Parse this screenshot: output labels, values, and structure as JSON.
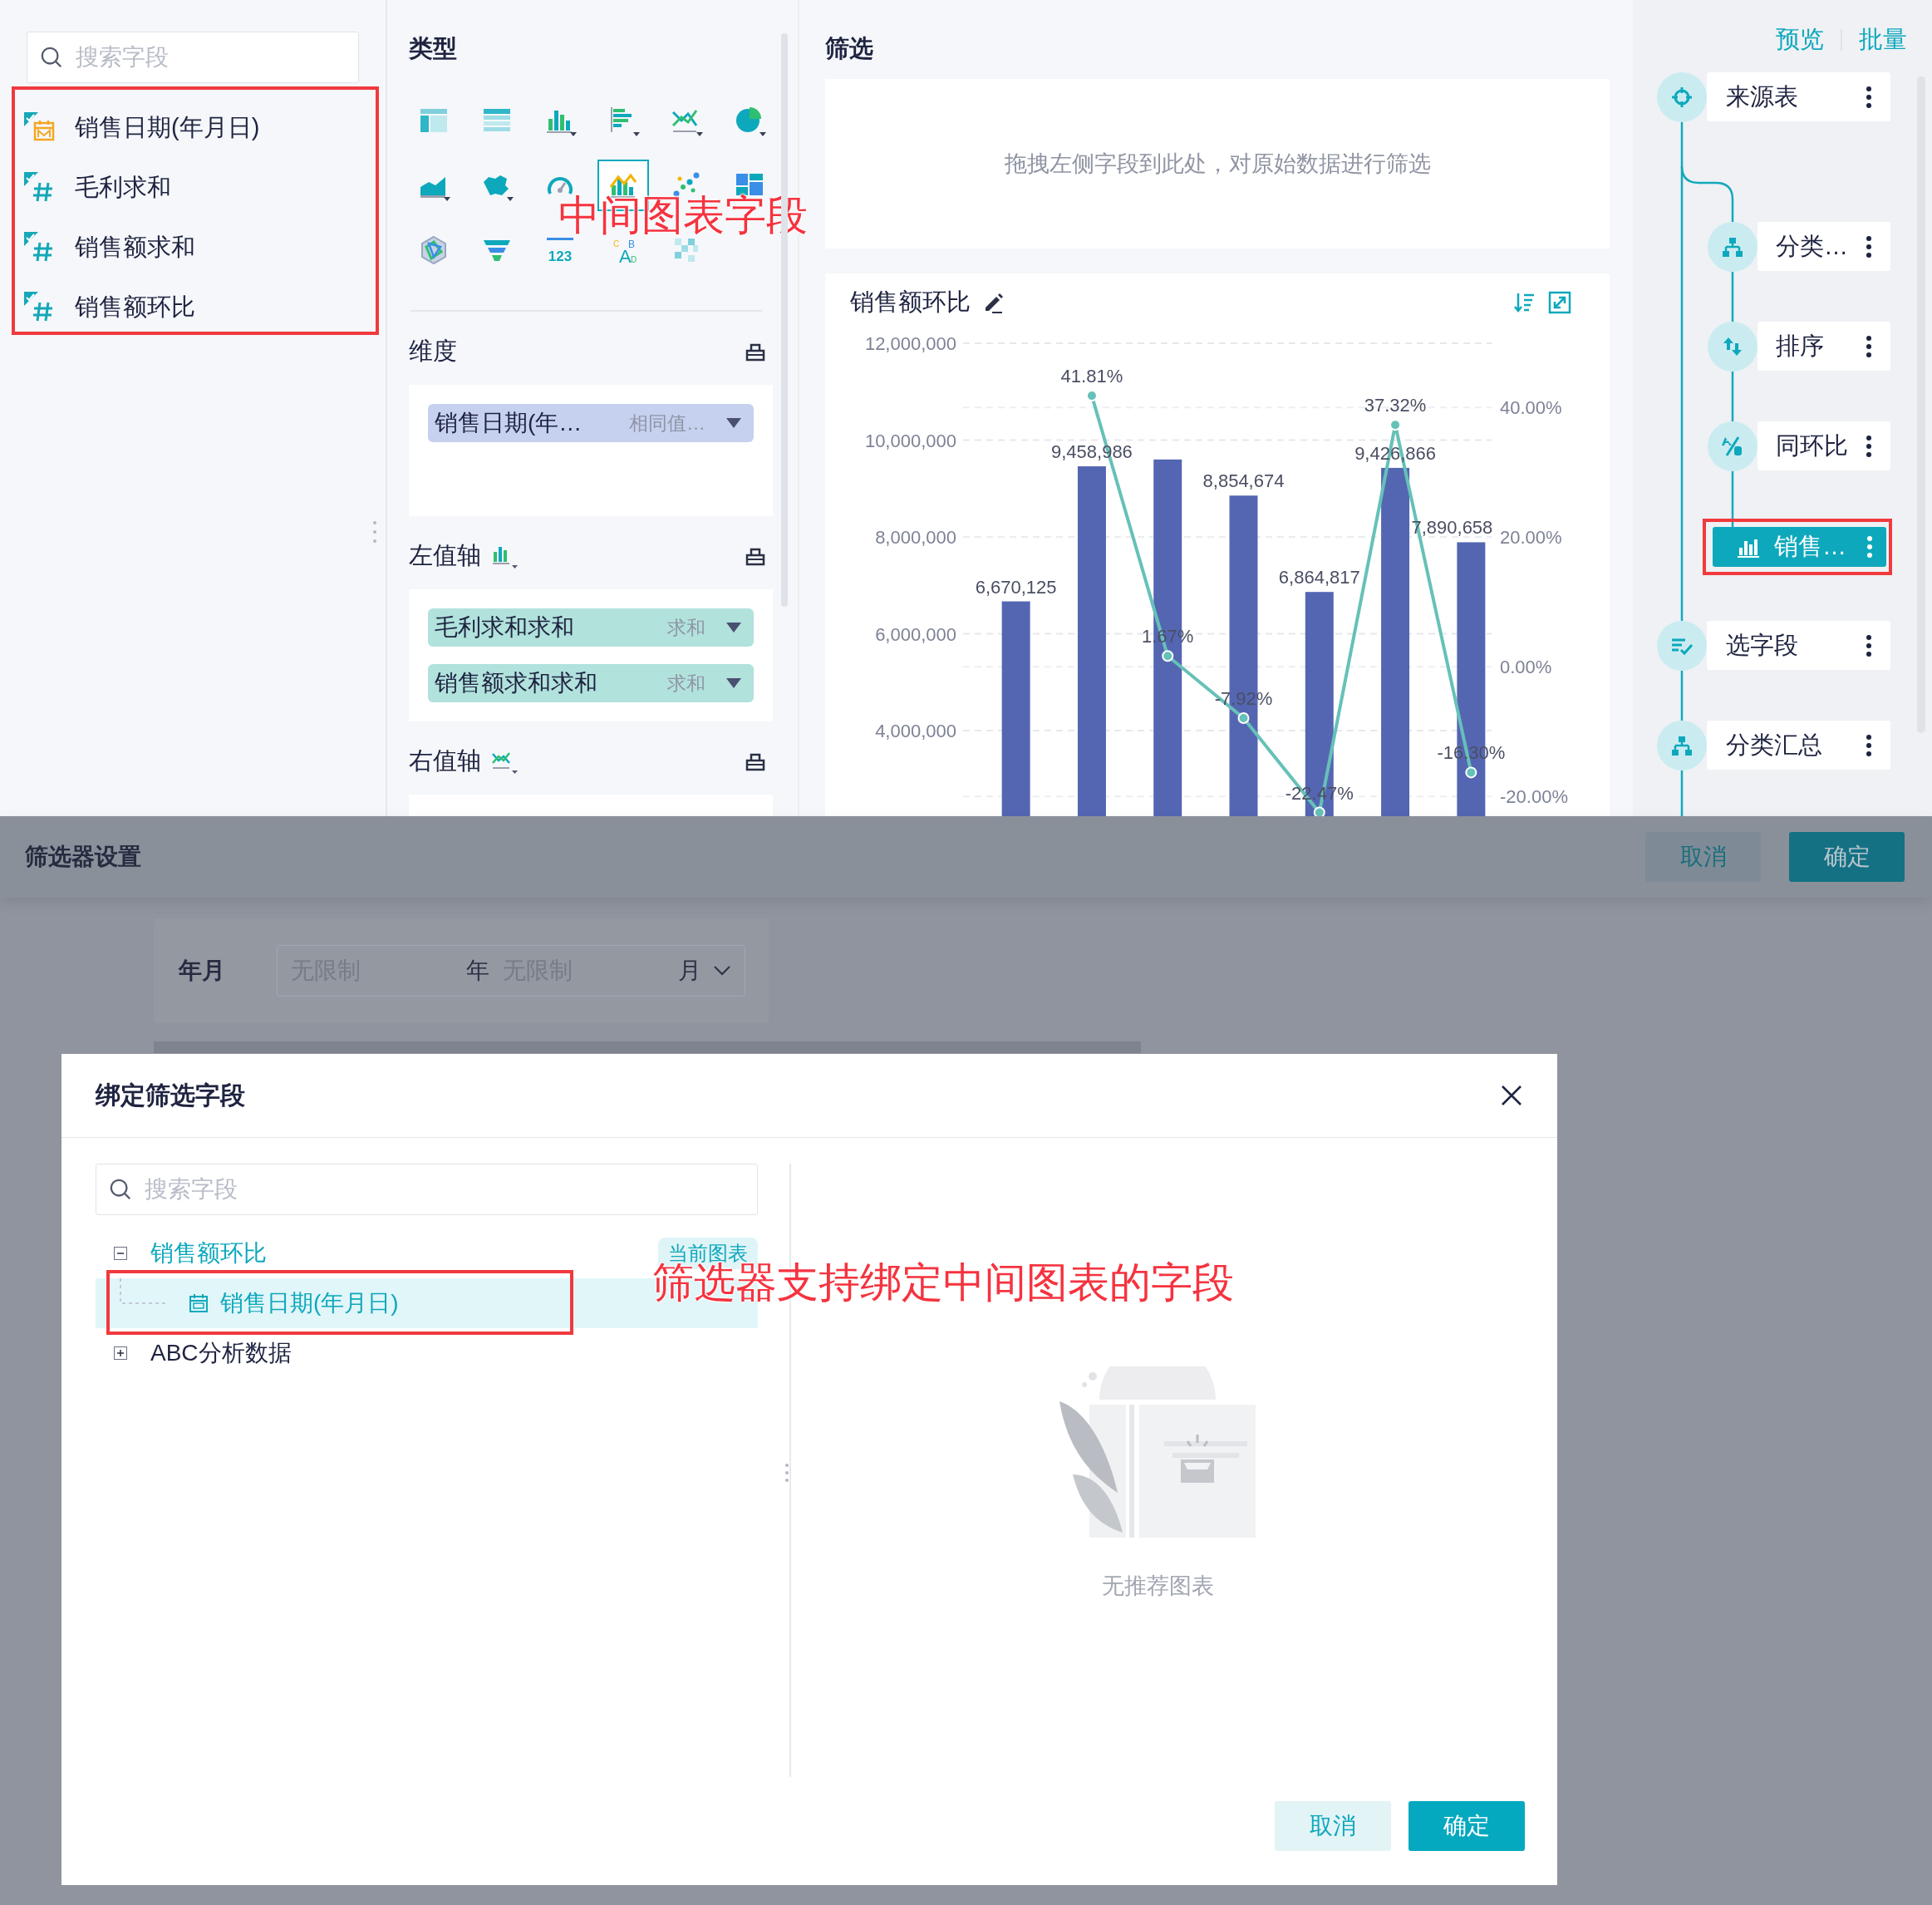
{
  "field_panel": {
    "search": {
      "placeholder": "搜索字段"
    },
    "annotated": true,
    "fields": [
      {
        "label": "销售日期(年月日)",
        "kind": "date"
      },
      {
        "label": "毛利求和",
        "kind": "number"
      },
      {
        "label": "销售额求和",
        "kind": "number"
      },
      {
        "label": "销售额环比",
        "kind": "number"
      }
    ]
  },
  "type_panel": {
    "title": "类型",
    "annotation": "中间图表字段",
    "chart_types": [
      {
        "kind": "table",
        "menu": false,
        "selected": false
      },
      {
        "kind": "crosstab",
        "menu": false,
        "selected": false
      },
      {
        "kind": "bar",
        "menu": true,
        "selected": false
      },
      {
        "kind": "hbar",
        "menu": true,
        "selected": false
      },
      {
        "kind": "line",
        "menu": true,
        "selected": false
      },
      {
        "kind": "pie",
        "menu": true,
        "selected": false
      },
      {
        "kind": "area",
        "menu": true,
        "selected": false
      },
      {
        "kind": "map",
        "menu": true,
        "selected": false
      },
      {
        "kind": "gauge",
        "menu": false,
        "selected": false
      },
      {
        "kind": "combo",
        "menu": false,
        "selected": true
      },
      {
        "kind": "scatter",
        "menu": false,
        "selected": false
      },
      {
        "kind": "treemap",
        "menu": false,
        "selected": false
      },
      {
        "kind": "radar",
        "menu": false,
        "selected": false
      },
      {
        "kind": "funnel",
        "menu": false,
        "selected": false
      },
      {
        "kind": "kpi",
        "glyph": "123",
        "menu": false,
        "selected": false
      },
      {
        "kind": "wordcloud",
        "glyph": "CABD",
        "menu": false,
        "selected": false
      },
      {
        "kind": "heatmap",
        "menu": false,
        "selected": false
      }
    ],
    "sections": [
      {
        "label": "维度",
        "kind": "dimension",
        "pills": [
          {
            "name": "销售日期(年…",
            "tag": "相同值…"
          }
        ]
      },
      {
        "label": "左值轴",
        "kind": "left_axis",
        "pills": [
          {
            "name": "毛利求和求和",
            "tag": "求和"
          },
          {
            "name": "销售额求和求和",
            "tag": "求和"
          }
        ]
      },
      {
        "label": "右值轴",
        "kind": "right_axis"
      }
    ]
  },
  "filter_area": {
    "title": "筛选",
    "hint": "拖拽左侧字段到此处，对原始数据进行筛选"
  },
  "chart_card": {
    "title": "销售额环比",
    "chart_data": {
      "type": "bar",
      "grid": true,
      "stacked": false,
      "ylim": [
        2200000,
        12000000
      ],
      "y2lim": [
        -23.3,
        49.9
      ],
      "series": [
        {
          "type": "bar",
          "color": "#5466b2",
          "values": [
            6670125,
            9458986,
            9600000,
            8854674,
            6864817,
            9426866,
            7890658
          ],
          "value_labels": [
            "6,670,125",
            "9,458,986",
            null,
            "8,854,674",
            "6,864,817",
            "9,426,866",
            "7,890,658"
          ]
        },
        {
          "type": "line",
          "color": "#66c1b8",
          "axis": "y2",
          "marker": true,
          "values": [
            null,
            41.81,
            1.67,
            -7.92,
            -22.47,
            37.32,
            -16.3
          ],
          "value_labels": [
            null,
            "41.81%",
            "1.67%",
            "-7.92%",
            "-22.47%",
            "37.32%",
            "-16.30%"
          ]
        }
      ],
      "yticks": [
        {
          "value": 4000000,
          "label": "4,000,000"
        },
        {
          "value": 6000000,
          "label": "6,000,000"
        },
        {
          "value": 8000000,
          "label": "8,000,000"
        },
        {
          "value": 10000000,
          "label": "10,000,000"
        },
        {
          "value": 12000000,
          "label": "12,000,000"
        }
      ],
      "y2ticks": [
        {
          "value": -20,
          "label": "-20.00%"
        },
        {
          "value": 0,
          "label": "0.00%"
        },
        {
          "value": 20,
          "label": "20.00%"
        },
        {
          "value": 40,
          "label": "40.00%"
        }
      ]
    }
  },
  "flow_panel": {
    "links": [
      {
        "label": "预览"
      },
      {
        "label": "批量"
      }
    ],
    "nodes": [
      {
        "label": "来源表",
        "kind": "source",
        "selected": false,
        "children": [
          {
            "label": "分类…",
            "kind": "group",
            "selected": false
          },
          {
            "label": "排序",
            "kind": "sort",
            "selected": false
          },
          {
            "label": "同环比",
            "kind": "ratio",
            "selected": false
          },
          {
            "label": "销售…",
            "kind": "chart",
            "selected": true,
            "annotated": true
          }
        ]
      },
      {
        "label": "选字段",
        "kind": "select",
        "selected": false
      },
      {
        "label": "分类汇总",
        "kind": "group",
        "selected": false
      }
    ]
  },
  "filter_settings": {
    "title": "筛选器设置",
    "buttons": [
      {
        "label": "取消",
        "kind": "secondary"
      },
      {
        "label": "确定",
        "kind": "primary"
      }
    ],
    "filter": {
      "label": "年月",
      "from_placeholder": "无限制",
      "from_unit": "年",
      "to_placeholder": "无限制",
      "to_unit": "月"
    }
  },
  "bind_dialog": {
    "title": "绑定筛选字段",
    "search": {
      "placeholder": "搜索字段"
    },
    "tree": [
      {
        "label": "销售额环比",
        "badge": "当前图表",
        "expanded": true,
        "selected": false,
        "children": [
          {
            "label": "销售日期(年月日)",
            "selected": true,
            "annotated": true
          }
        ]
      },
      {
        "label": "ABC分析数据",
        "expanded": false,
        "selected": false
      }
    ],
    "annotation": "筛选器支持绑定中间图表的字段",
    "empty_text": "无推荐图表",
    "buttons": [
      {
        "label": "取消",
        "kind": "secondary"
      },
      {
        "label": "确定",
        "kind": "primary"
      }
    ]
  }
}
